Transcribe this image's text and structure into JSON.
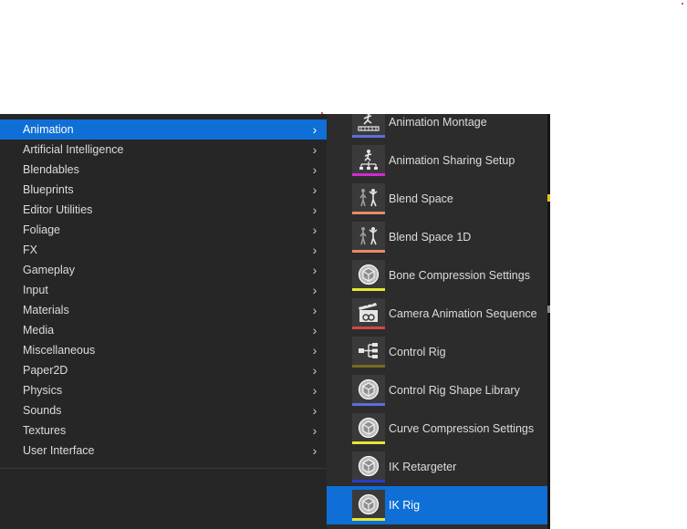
{
  "menu": {
    "items": [
      {
        "label": "Animation",
        "selected": true
      },
      {
        "label": "Artificial Intelligence"
      },
      {
        "label": "Blendables"
      },
      {
        "label": "Blueprints"
      },
      {
        "label": "Editor Utilities"
      },
      {
        "label": "Foliage"
      },
      {
        "label": "FX"
      },
      {
        "label": "Gameplay"
      },
      {
        "label": "Input"
      },
      {
        "label": "Materials"
      },
      {
        "label": "Media"
      },
      {
        "label": "Miscellaneous"
      },
      {
        "label": "Paper2D"
      },
      {
        "label": "Physics"
      },
      {
        "label": "Sounds"
      },
      {
        "label": "Textures"
      },
      {
        "label": "User Interface"
      }
    ]
  },
  "submenu": {
    "items": [
      {
        "label": "Animation Montage",
        "icon": "montage-icon",
        "color": "#5b6ee0"
      },
      {
        "label": "Animation Sharing Setup",
        "icon": "sharing-setup-icon",
        "color": "#d02bd0"
      },
      {
        "label": "Blend Space",
        "icon": "blend-space-icon",
        "color": "#e8896a"
      },
      {
        "label": "Blend Space 1D",
        "icon": "blend-space-1d-icon",
        "color": "#e8896a"
      },
      {
        "label": "Bone Compression Settings",
        "icon": "data-asset-icon",
        "color": "#e6e635"
      },
      {
        "label": "Camera Animation Sequence",
        "icon": "clapperboard-icon",
        "color": "#d04848"
      },
      {
        "label": "Control Rig",
        "icon": "control-rig-icon",
        "color": "#7a6a1e"
      },
      {
        "label": "Control Rig Shape Library",
        "icon": "data-asset-icon",
        "color": "#5b6ee0"
      },
      {
        "label": "Curve Compression Settings",
        "icon": "data-asset-icon",
        "color": "#e6e635"
      },
      {
        "label": "IK Retargeter",
        "icon": "data-asset-icon",
        "color": "#283cc8"
      },
      {
        "label": "IK Rig",
        "icon": "data-asset-icon",
        "color": "#e6e635",
        "selected": true
      }
    ]
  }
}
